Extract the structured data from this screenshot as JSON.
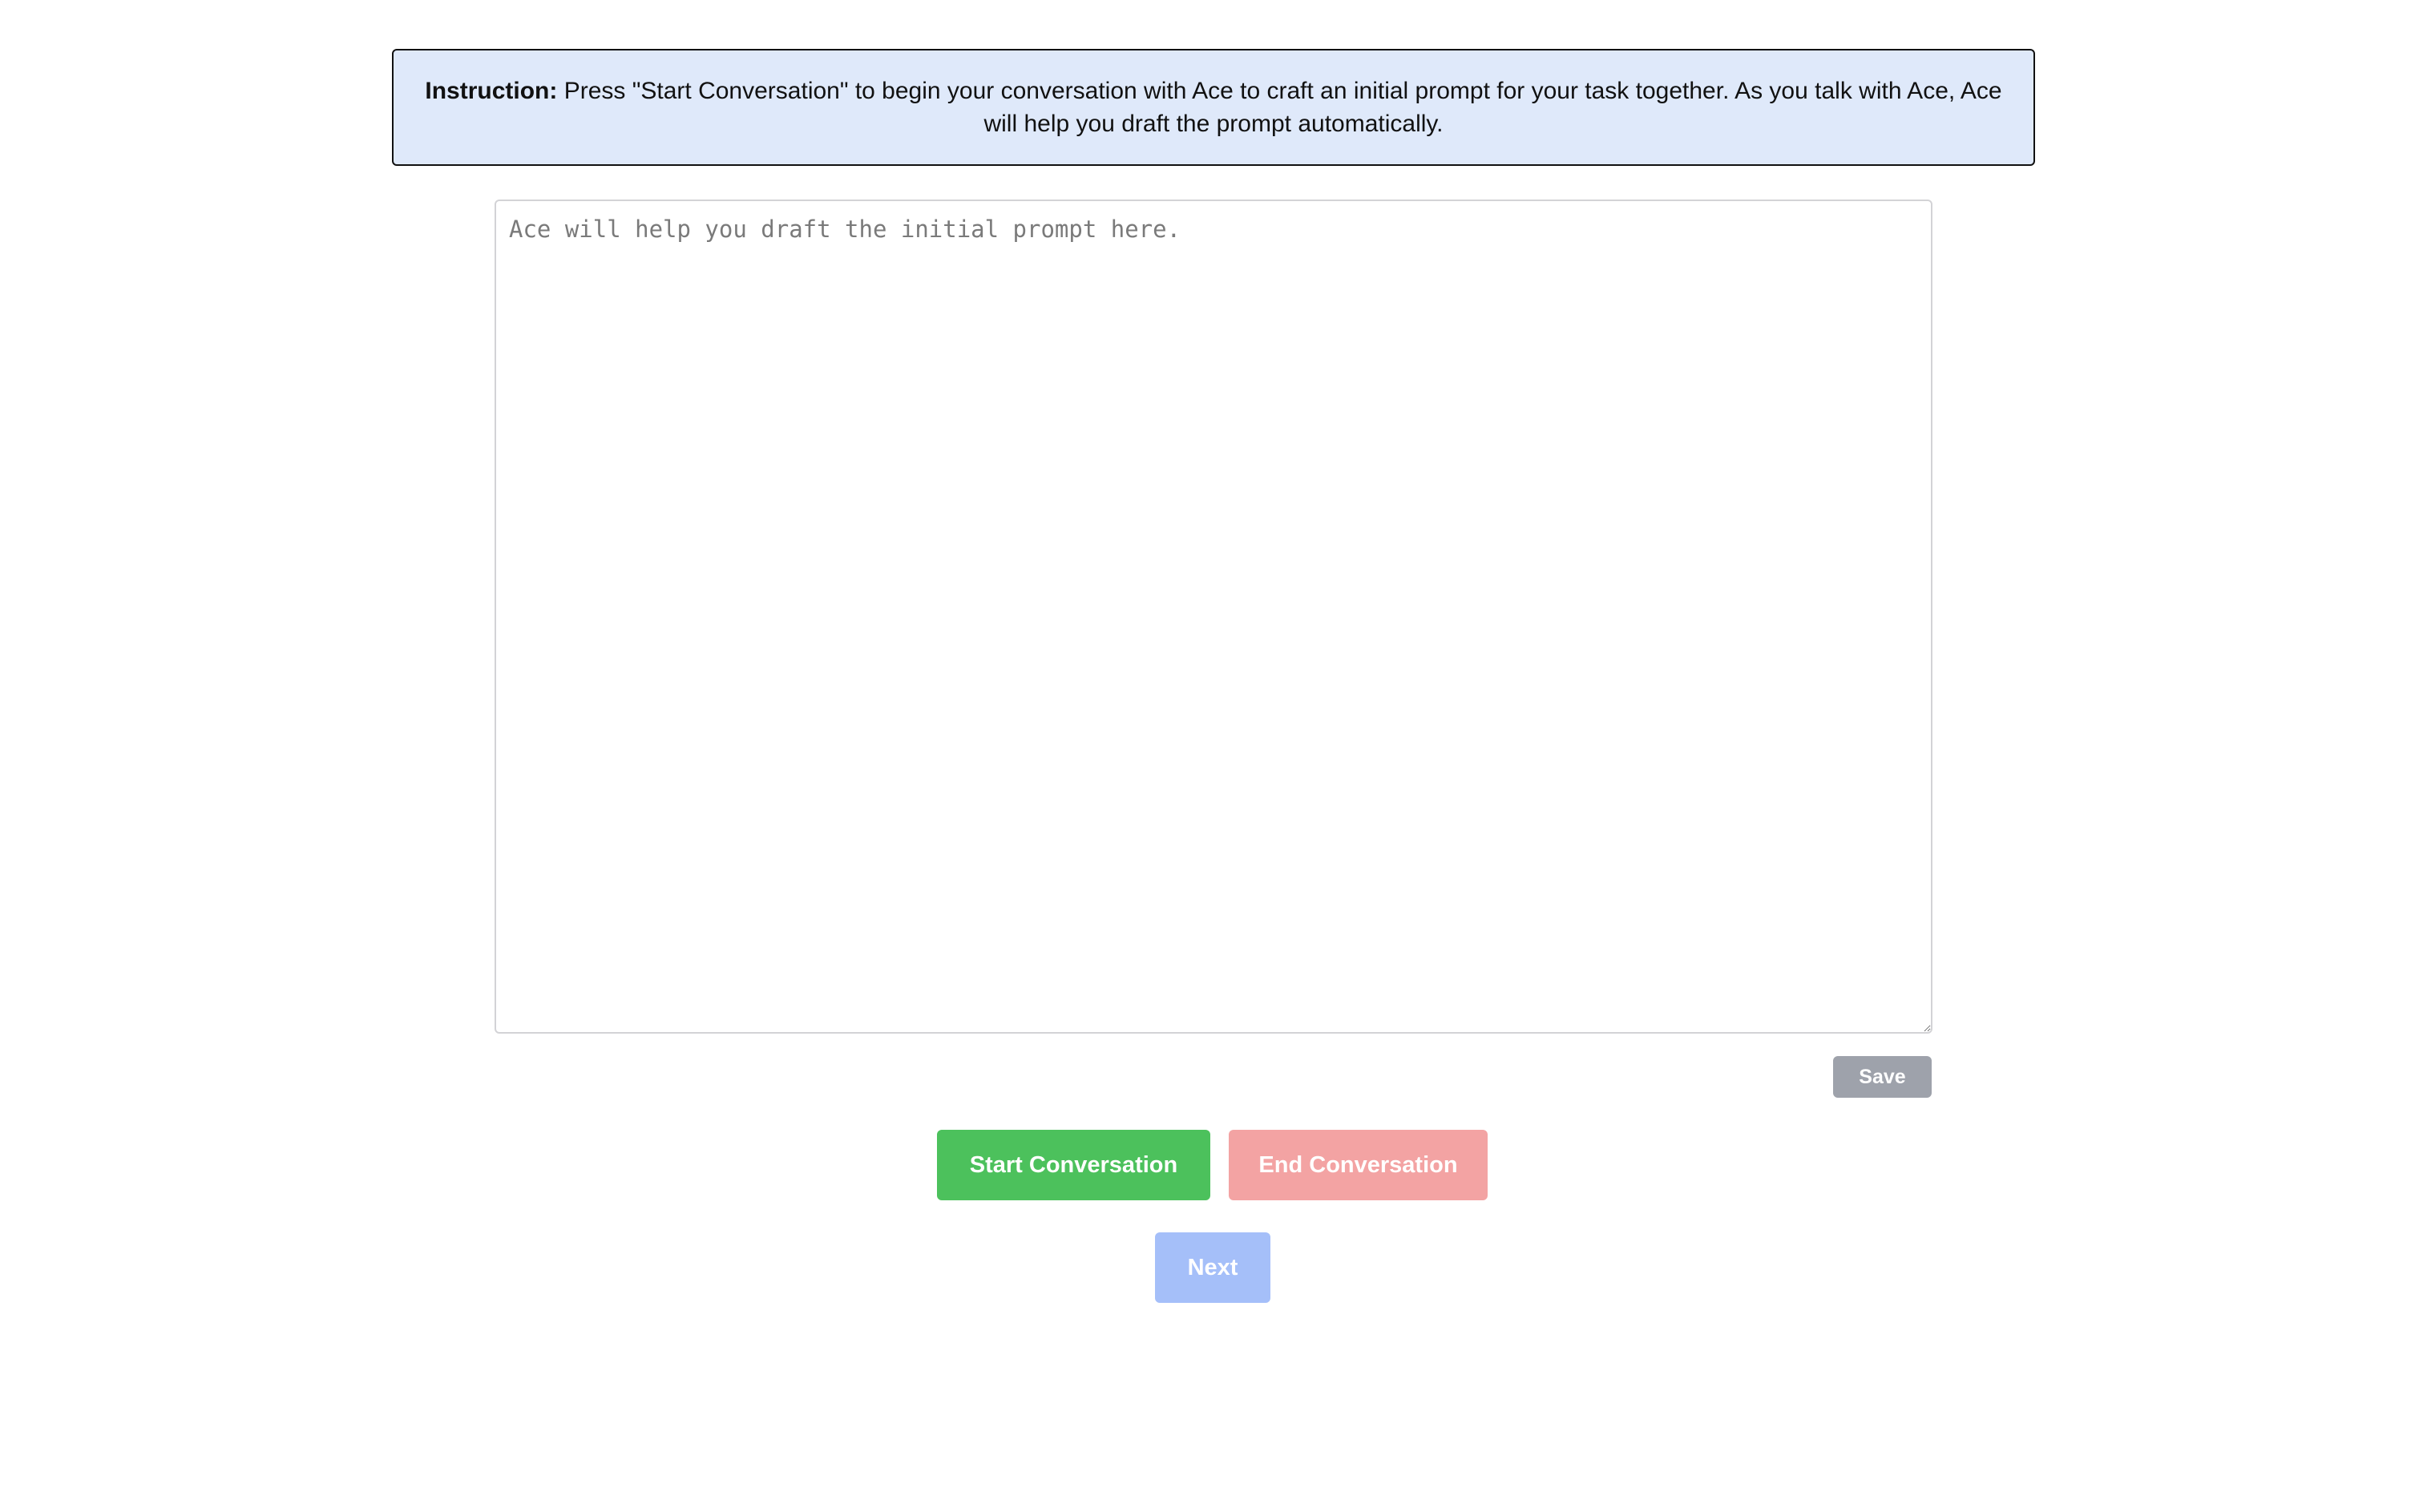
{
  "instruction": {
    "label": "Instruction:",
    "text": " Press \"Start Conversation\" to begin your conversation with Ace to craft an initial prompt for your task together. As you talk with Ace, Ace will help you draft the prompt automatically."
  },
  "prompt_editor": {
    "value": "",
    "placeholder": "Ace will help you draft the initial prompt here."
  },
  "buttons": {
    "save": "Save",
    "start_conversation": "Start Conversation",
    "end_conversation": "End Conversation",
    "next": "Next"
  },
  "colors": {
    "instruction_background": "#dfe9fa",
    "save_button": "#9ea2ab",
    "start_button": "#4cc15c",
    "end_button_disabled": "#f3a3a3",
    "next_button_disabled": "#a5bff9"
  }
}
